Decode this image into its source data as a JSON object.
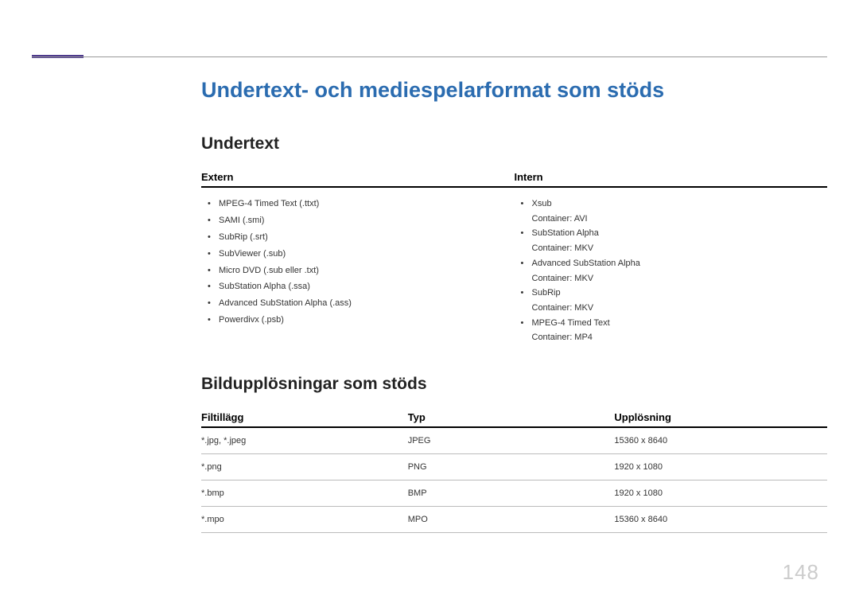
{
  "page_number": "148",
  "main_heading": "Undertext- och mediespelarformat som stöds",
  "section1": {
    "heading": "Undertext",
    "col_headers": [
      "Extern",
      "Intern"
    ],
    "extern": [
      "MPEG-4 Timed Text (.ttxt)",
      "SAMI (.smi)",
      "SubRip (.srt)",
      "SubViewer (.sub)",
      "Micro DVD (.sub eller .txt)",
      "SubStation Alpha (.ssa)",
      "Advanced SubStation Alpha (.ass)",
      "Powerdivx (.psb)"
    ],
    "intern": [
      {
        "name": "Xsub",
        "container": "Container: AVI"
      },
      {
        "name": "SubStation Alpha",
        "container": "Container: MKV"
      },
      {
        "name": "Advanced SubStation Alpha",
        "container": "Container: MKV"
      },
      {
        "name": "SubRip",
        "container": "Container: MKV"
      },
      {
        "name": "MPEG-4 Timed Text",
        "container": "Container: MP4"
      }
    ]
  },
  "section2": {
    "heading": "Bildupplösningar som stöds",
    "headers": [
      "Filtillägg",
      "Typ",
      "Upplösning"
    ],
    "rows": [
      {
        "ext": "*.jpg, *.jpeg",
        "type": "JPEG",
        "res": "15360 x 8640"
      },
      {
        "ext": "*.png",
        "type": "PNG",
        "res": "1920 x 1080"
      },
      {
        "ext": "*.bmp",
        "type": "BMP",
        "res": "1920 x 1080"
      },
      {
        "ext": "*.mpo",
        "type": "MPO",
        "res": "15360 x 8640"
      }
    ]
  }
}
